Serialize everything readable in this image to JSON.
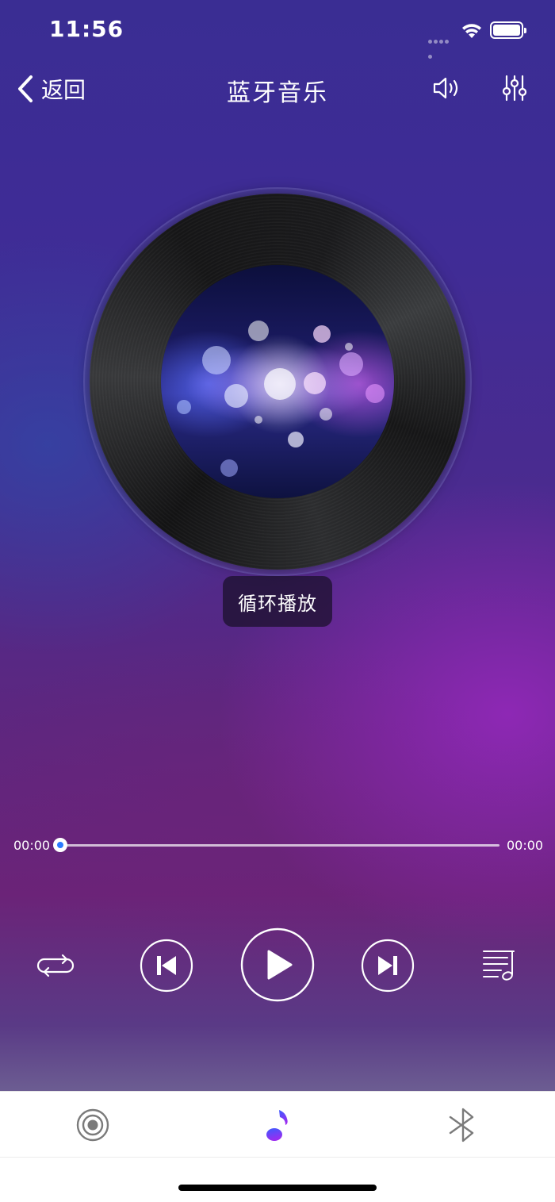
{
  "status_bar": {
    "time": "11:56"
  },
  "nav": {
    "back_label": "返回",
    "title": "蓝牙音乐"
  },
  "player": {
    "mode_label": "循环播放",
    "current_time": "00:00",
    "total_time": "00:00",
    "progress": 0
  },
  "colors": {
    "accent": "#2a7bff",
    "tab_active_gradient": [
      "#3b5bff",
      "#9b2cf0"
    ],
    "tab_inactive": "#7a7a7a"
  },
  "controls": {
    "icons": [
      "repeat-icon",
      "previous-icon",
      "play-icon",
      "next-icon",
      "playlist-icon"
    ]
  },
  "tabbar": {
    "tabs": [
      {
        "icon": "radio-icon",
        "active": false
      },
      {
        "icon": "music-note-icon",
        "active": true
      },
      {
        "icon": "bluetooth-icon",
        "active": false
      }
    ]
  }
}
